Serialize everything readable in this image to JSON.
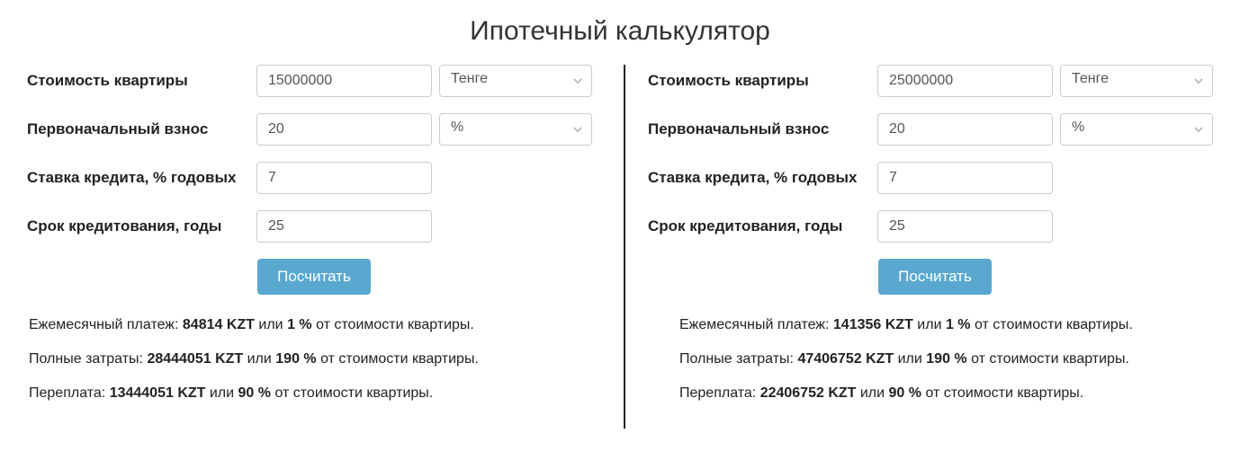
{
  "title": "Ипотечный калькулятор",
  "labels": {
    "price": "Стоимость квартиры",
    "down": "Первоначальный взнос",
    "rate": "Ставка кредита, % годовых",
    "term": "Срок кредитования, годы",
    "button": "Посчитать"
  },
  "units": {
    "currency": "Тенге",
    "percent": "%"
  },
  "left": {
    "price": "15000000",
    "down": "20",
    "rate": "7",
    "term": "25",
    "results": {
      "monthly_pre": "Ежемесячный платеж: ",
      "monthly_val": "84814 KZT",
      "monthly_mid": " или ",
      "monthly_pct": "1 %",
      "monthly_post": " от стоимости квартиры.",
      "full_pre": "Полные затраты:  ",
      "full_val": "28444051 KZT",
      "full_mid": " или ",
      "full_pct": "190 %",
      "full_post": " от стоимости квартиры.",
      "over_pre": "Переплата: ",
      "over_val": "13444051 KZT",
      "over_mid": " или ",
      "over_pct": "90 %",
      "over_post": " от стоимости квартиры."
    }
  },
  "right": {
    "price": "25000000",
    "down": "20",
    "rate": "7",
    "term": "25",
    "results": {
      "monthly_pre": "Ежемесячный платеж: ",
      "monthly_val": "141356 KZT",
      "monthly_mid": " или ",
      "monthly_pct": "1 %",
      "monthly_post": " от стоимости квартиры.",
      "full_pre": "Полные затраты: ",
      "full_val": "47406752 KZT",
      "full_mid": " или ",
      "full_pct": "190 %",
      "full_post": " от стоимости квартиры.",
      "over_pre": "Переплата: ",
      "over_val": "22406752 KZT",
      "over_mid": " или ",
      "over_pct": "90 %",
      "over_post": " от стоимости квартиры."
    }
  }
}
